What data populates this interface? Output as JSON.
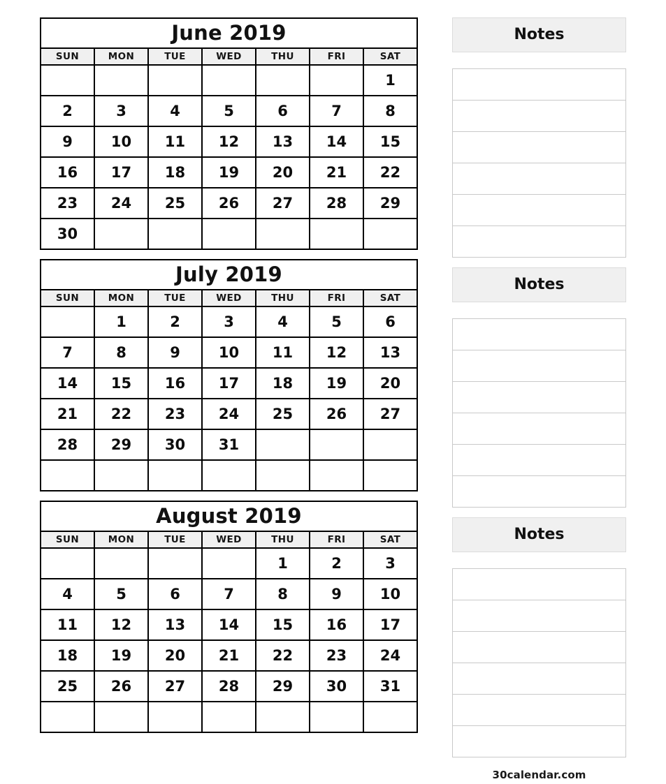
{
  "page": {
    "background_color": "#ffffff",
    "grid_border_color": "#000000",
    "header_fill_color": "#f0f0f0",
    "notes_border_color": "#c9c9c9"
  },
  "calendars": [
    {
      "title": "June 2019",
      "weekdays": [
        "SUN",
        "MON",
        "TUE",
        "WED",
        "THU",
        "FRI",
        "SAT"
      ],
      "weeks": [
        [
          "",
          "",
          "",
          "",
          "",
          "",
          "1"
        ],
        [
          "2",
          "3",
          "4",
          "5",
          "6",
          "7",
          "8"
        ],
        [
          "9",
          "10",
          "11",
          "12",
          "13",
          "14",
          "15"
        ],
        [
          "16",
          "17",
          "18",
          "19",
          "20",
          "21",
          "22"
        ],
        [
          "23",
          "24",
          "25",
          "26",
          "27",
          "28",
          "29"
        ],
        [
          "30",
          "",
          "",
          "",
          "",
          "",
          ""
        ]
      ]
    },
    {
      "title": "July 2019",
      "weekdays": [
        "SUN",
        "MON",
        "TUE",
        "WED",
        "THU",
        "FRI",
        "SAT"
      ],
      "weeks": [
        [
          "",
          "1",
          "2",
          "3",
          "4",
          "5",
          "6"
        ],
        [
          "7",
          "8",
          "9",
          "10",
          "11",
          "12",
          "13"
        ],
        [
          "14",
          "15",
          "16",
          "17",
          "18",
          "19",
          "20"
        ],
        [
          "21",
          "22",
          "23",
          "24",
          "25",
          "26",
          "27"
        ],
        [
          "28",
          "29",
          "30",
          "31",
          "",
          "",
          ""
        ],
        [
          "",
          "",
          "",
          "",
          "",
          "",
          ""
        ]
      ]
    },
    {
      "title": "August 2019",
      "weekdays": [
        "SUN",
        "MON",
        "TUE",
        "WED",
        "THU",
        "FRI",
        "SAT"
      ],
      "weeks": [
        [
          "",
          "",
          "",
          "",
          "1",
          "2",
          "3"
        ],
        [
          "4",
          "5",
          "6",
          "7",
          "8",
          "9",
          "10"
        ],
        [
          "11",
          "12",
          "13",
          "14",
          "15",
          "16",
          "17"
        ],
        [
          "18",
          "19",
          "20",
          "21",
          "22",
          "23",
          "24"
        ],
        [
          "25",
          "26",
          "27",
          "28",
          "29",
          "30",
          "31"
        ],
        [
          "",
          "",
          "",
          "",
          "",
          "",
          ""
        ]
      ]
    }
  ],
  "notes_panels": [
    {
      "title": "Notes",
      "line_count": 6,
      "lines": [
        "",
        "",
        "",
        "",
        "",
        ""
      ]
    },
    {
      "title": "Notes",
      "line_count": 6,
      "lines": [
        "",
        "",
        "",
        "",
        "",
        ""
      ]
    },
    {
      "title": "Notes",
      "line_count": 6,
      "lines": [
        "",
        "",
        "",
        "",
        "",
        ""
      ]
    }
  ],
  "footer": {
    "watermark": "30calendar.com"
  }
}
